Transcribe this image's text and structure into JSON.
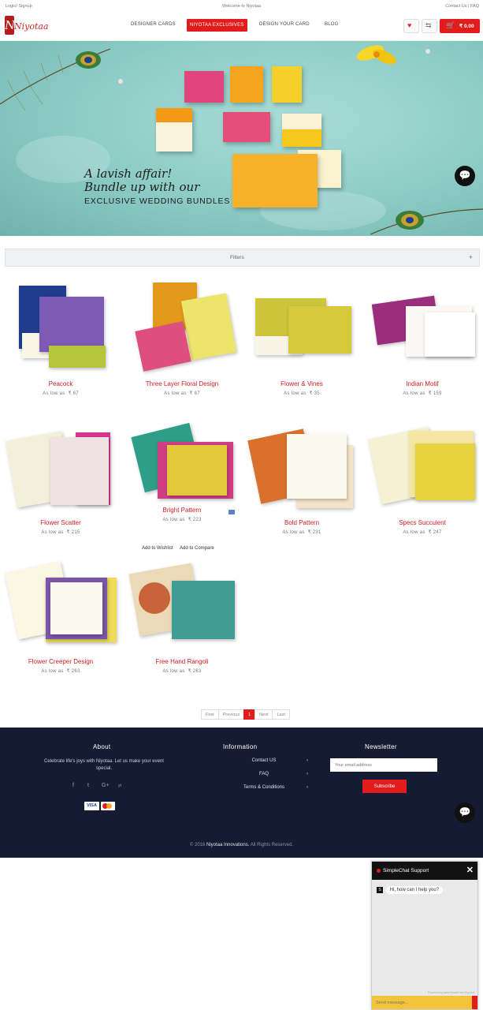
{
  "topbar": {
    "login": "Login/ Signup",
    "welcome": "Welcome to Niyotaa",
    "contact": "Contact Us",
    "faq": "FAQ"
  },
  "header": {
    "logo_text": "Niyotaa",
    "logo_letter": "N",
    "nav": [
      "DESIGNER CARDS",
      "NIYOTAA EXCLUSIVES",
      "DESIGN YOUR CARD",
      "BLOG"
    ],
    "wishlist_count": "0",
    "compare_count": "0",
    "cart_count": "0",
    "cart_total": "₹ 0.00"
  },
  "hero": {
    "line1": "A lavish affair!",
    "line2": "Bundle up with our",
    "line3": "EXCLUSIVE WEDDING BUNDLES"
  },
  "filters": {
    "label": "Filters",
    "toggle": "+"
  },
  "products": [
    {
      "name": "Peacock",
      "price_prefix": "As low as",
      "price": "₹ 67"
    },
    {
      "name": "Three Layer Floral Design",
      "price_prefix": "As low as",
      "price": "₹ 67"
    },
    {
      "name": "Flower & Vines",
      "price_prefix": "As low as",
      "price": "₹ 35"
    },
    {
      "name": "Indian Motif",
      "price_prefix": "As low as",
      "price": "₹ 159"
    },
    {
      "name": "Flower Scatter",
      "price_prefix": "As low as",
      "price": "₹ 215"
    },
    {
      "name": "Bright Pattern",
      "price_prefix": "As low as",
      "price": "₹ 223"
    },
    {
      "name": "Bold Pattern",
      "price_prefix": "As low as",
      "price": "₹ 231"
    },
    {
      "name": "Specs Succulent",
      "price_prefix": "As low as",
      "price": "₹ 247"
    },
    {
      "name": "Flower Creeper Design",
      "price_prefix": "As low as",
      "price": "₹ 263"
    },
    {
      "name": "Free Hand Rangoli",
      "price_prefix": "As low as",
      "price": "₹ 263"
    }
  ],
  "hover_actions": {
    "wishlist": "Add to Wishlist",
    "compare": "Add to Compare"
  },
  "pagination": {
    "first": "First",
    "previous": "Previous",
    "current": "1",
    "next": "Next",
    "last": "Last"
  },
  "footer": {
    "about_title": "About",
    "about_text": "Celebrate life's joys with Niyotaa. Let us make your event special.",
    "info_title": "Information",
    "info_links": [
      "Contact US",
      "FAQ",
      "Terms & Conditions"
    ],
    "newsletter_title": "Newsletter",
    "newsletter_placeholder": "Your email address",
    "subscribe": "Subscribe",
    "social": [
      "f",
      "t",
      "G+",
      "yt"
    ],
    "payments": [
      "VISA",
      "mastercard"
    ],
    "copyright_prefix": "© 2016",
    "copyright_brand": "Niyotaa Innovations.",
    "copyright_suffix": "All Rights Reserved."
  },
  "chat": {
    "title": "SimpleChat Support",
    "close": "✕",
    "agent_initial": "S",
    "greeting": "Hi, how can I help you?",
    "powered": "Powered by www.SimpleChat.Support",
    "placeholder": "Send message..."
  },
  "colors": {
    "brand_red": "#e31b1b",
    "footer_navy": "#151b33",
    "hero_teal": "#8ccbc5"
  }
}
